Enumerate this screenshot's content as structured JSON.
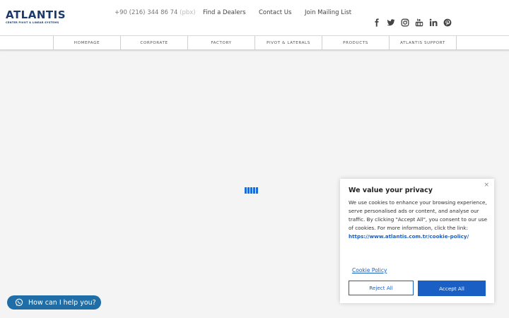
{
  "brand": {
    "name": "ATLANTIS",
    "tagline": "CENTER PIVOT & LINEAR SYSTEMS",
    "color": "#1b3a6b"
  },
  "header": {
    "phone": "+90 (216) 344 86 74",
    "phone_faded": " (pbx)",
    "links": {
      "dealers": "Find a Dealers",
      "contact": "Contact Us",
      "mailing": "Join Mailing List"
    },
    "social": [
      "facebook-icon",
      "twitter-icon",
      "instagram-icon",
      "youtube-icon",
      "linkedin-icon",
      "pinterest-icon"
    ]
  },
  "nav": {
    "items": [
      "HOMEPAGE",
      "CORPORATE",
      "FACTORY",
      "PIVOT & LATERALS",
      "PRODUCTS",
      "ATLANTIS SUPPORT"
    ]
  },
  "loader": {
    "icon": "loading-bars-icon",
    "color": "#1a6cd6"
  },
  "cookie": {
    "close": "×",
    "title": "We value your privacy",
    "body": "We use cookies to enhance your browsing experience, serve personalised ads or content, and analyse our traffic. By clicking \"Accept All\", you consent to our use of cookies. For more information, click the link:",
    "link": "https://www.atlantis.com.tr/cookie-policy/",
    "policy_label": "Cookie Policy",
    "reject_label": "Reject All",
    "accept_label": "Accept All",
    "accent": "#1a5fc4"
  },
  "help": {
    "label": "How can I help you?",
    "icon": "whatsapp-icon",
    "color": "#1f6ea8"
  }
}
